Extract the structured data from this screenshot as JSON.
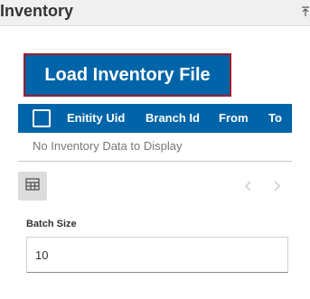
{
  "header": {
    "title": "Inventory"
  },
  "actions": {
    "load_label": "Load Inventory File"
  },
  "grid": {
    "columns": [
      "Enitity Uid",
      "Branch Id",
      "From",
      "To"
    ],
    "empty_message": "No Inventory Data to Display"
  },
  "form": {
    "batch_size_label": "Batch Size",
    "batch_size_value": "10"
  },
  "icons": {
    "pin": "pin-icon",
    "select_all": "checkbox-icon",
    "table_view": "table-icon",
    "prev": "chevron-left-icon",
    "next": "chevron-right-icon"
  },
  "colors": {
    "accent": "#0064a8",
    "button_border": "#a01d2b",
    "header_bg": "#f0f0f0",
    "pager_disabled": "#cccccc"
  }
}
